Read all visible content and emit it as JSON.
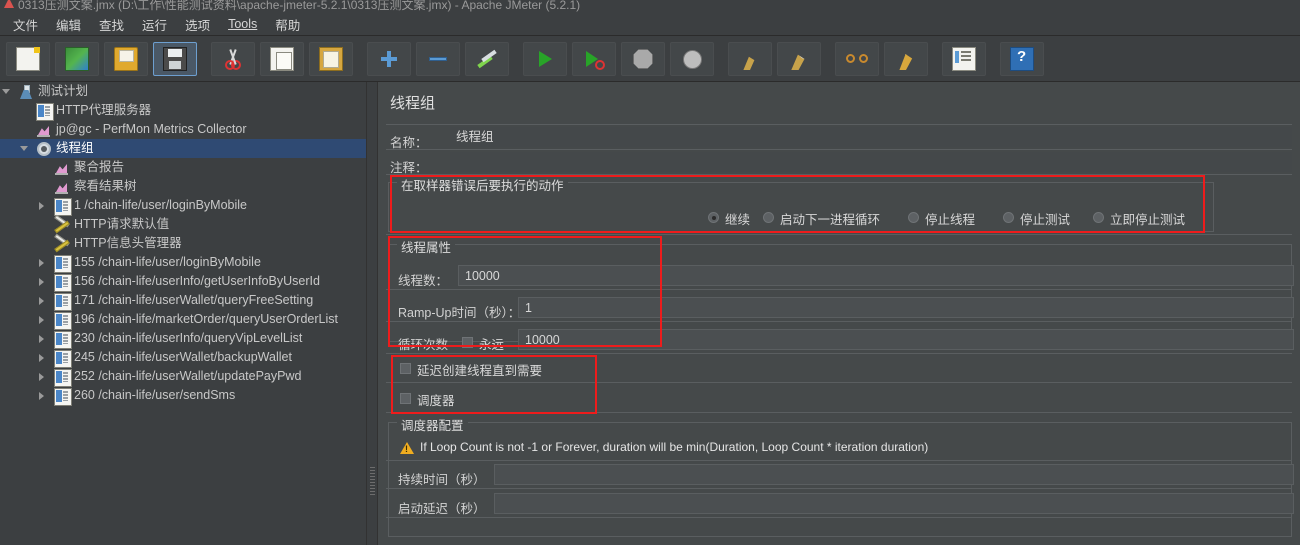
{
  "window": {
    "title": "0313压测文案.jmx (D:\\工作\\性能测试资料\\apache-jmeter-5.2.1\\0313压测文案.jmx) - Apache JMeter (5.2.1)",
    "app_icon": "jmeter-icon"
  },
  "menu": {
    "items": [
      {
        "label": "文件",
        "name": "menu-file"
      },
      {
        "label": "编辑",
        "name": "menu-edit"
      },
      {
        "label": "查找",
        "name": "menu-search"
      },
      {
        "label": "运行",
        "name": "menu-run"
      },
      {
        "label": "选项",
        "name": "menu-options"
      },
      {
        "label": "Tools",
        "name": "menu-tools"
      },
      {
        "label": "帮助",
        "name": "menu-help"
      }
    ]
  },
  "toolbar": {
    "buttons": [
      {
        "name": "new-button",
        "icon": "new-document-icon",
        "tooltip": "新建",
        "selected": false
      },
      {
        "name": "templates-button",
        "icon": "templates-icon",
        "tooltip": "模板",
        "selected": false
      },
      {
        "name": "open-button",
        "icon": "open-folder-icon",
        "tooltip": "打开",
        "selected": false
      },
      {
        "name": "save-button",
        "icon": "save-disk-icon",
        "tooltip": "保存",
        "selected": true
      },
      {
        "name": "cut-button",
        "icon": "scissors-icon",
        "tooltip": "剪切",
        "selected": false
      },
      {
        "name": "copy-button",
        "icon": "copy-icon",
        "tooltip": "复制",
        "selected": false
      },
      {
        "name": "paste-button",
        "icon": "clipboard-paste-icon",
        "tooltip": "粘贴",
        "selected": false
      },
      {
        "name": "expand-all-button",
        "icon": "plus-icon",
        "tooltip": "展开全部",
        "selected": false
      },
      {
        "name": "collapse-all-button",
        "icon": "minus-icon",
        "tooltip": "折叠全部",
        "selected": false
      },
      {
        "name": "toggle-button",
        "icon": "toggle-icon",
        "tooltip": "切换",
        "selected": false
      },
      {
        "name": "start-button",
        "icon": "play-green-icon",
        "tooltip": "启动",
        "selected": false
      },
      {
        "name": "start-no-pauses-button",
        "icon": "play-no-pause-icon",
        "tooltip": "无间断启动",
        "selected": false
      },
      {
        "name": "stop-button",
        "icon": "stop-octagon-icon",
        "tooltip": "停止",
        "selected": false
      },
      {
        "name": "shutdown-button",
        "icon": "shutdown-circle-icon",
        "tooltip": "关闭",
        "selected": false
      },
      {
        "name": "clear-button",
        "icon": "clear-broom-icon",
        "tooltip": "清除",
        "selected": false
      },
      {
        "name": "clear-all-button",
        "icon": "clear-all-broom-icon",
        "tooltip": "清除全部",
        "selected": false
      },
      {
        "name": "search-button",
        "icon": "binoculars-search-icon",
        "tooltip": "查找",
        "selected": false
      },
      {
        "name": "reset-search-button",
        "icon": "search-clear-icon",
        "tooltip": "重置查找",
        "selected": false
      },
      {
        "name": "function-helper-button",
        "icon": "function-helper-icon",
        "tooltip": "函数助手",
        "selected": false
      },
      {
        "name": "help-button",
        "icon": "help-book-icon",
        "tooltip": "帮助",
        "selected": false
      }
    ]
  },
  "tree": {
    "nodes": [
      {
        "label": "测试计划",
        "icon": "test-plan-icon",
        "depth": 0,
        "twisty": "open",
        "selected": false
      },
      {
        "label": "HTTP代理服务器",
        "icon": "http-icon",
        "depth": 1,
        "twisty": "none",
        "selected": false
      },
      {
        "label": "jp@gc - PerfMon Metrics Collector",
        "icon": "chart-icon",
        "depth": 1,
        "twisty": "none",
        "selected": false
      },
      {
        "label": "线程组",
        "icon": "gear-icon",
        "depth": 1,
        "twisty": "open",
        "selected": true
      },
      {
        "label": "聚合报告",
        "icon": "chart-icon",
        "depth": 2,
        "twisty": "none",
        "selected": false
      },
      {
        "label": "察看结果树",
        "icon": "chart-icon",
        "depth": 2,
        "twisty": "none",
        "selected": false
      },
      {
        "label": "1 /chain-life/user/loginByMobile",
        "icon": "http-icon",
        "depth": 2,
        "twisty": "closed",
        "selected": false
      },
      {
        "label": "HTTP请求默认值",
        "icon": "config-icon",
        "depth": 2,
        "twisty": "none",
        "selected": false
      },
      {
        "label": "HTTP信息头管理器",
        "icon": "config-icon",
        "depth": 2,
        "twisty": "none",
        "selected": false
      },
      {
        "label": "155 /chain-life/user/loginByMobile",
        "icon": "http-icon",
        "depth": 2,
        "twisty": "closed",
        "selected": false
      },
      {
        "label": "156 /chain-life/userInfo/getUserInfoByUserId",
        "icon": "http-icon",
        "depth": 2,
        "twisty": "closed",
        "selected": false
      },
      {
        "label": "171 /chain-life/userWallet/queryFreeSetting",
        "icon": "http-icon",
        "depth": 2,
        "twisty": "closed",
        "selected": false
      },
      {
        "label": "196 /chain-life/marketOrder/queryUserOrderList",
        "icon": "http-icon",
        "depth": 2,
        "twisty": "closed",
        "selected": false
      },
      {
        "label": "230 /chain-life/userInfo/queryVipLevelList",
        "icon": "http-icon",
        "depth": 2,
        "twisty": "closed",
        "selected": false
      },
      {
        "label": "245 /chain-life/userWallet/backupWallet",
        "icon": "http-icon",
        "depth": 2,
        "twisty": "closed",
        "selected": false
      },
      {
        "label": "252 /chain-life/userWallet/updatePayPwd",
        "icon": "http-icon",
        "depth": 2,
        "twisty": "closed",
        "selected": false
      },
      {
        "label": "260 /chain-life/user/sendSms",
        "icon": "http-icon",
        "depth": 2,
        "twisty": "closed",
        "selected": false
      }
    ]
  },
  "panel": {
    "title": "线程组",
    "name_label": "名称：",
    "name_value": "线程组",
    "comment_label": "注释：",
    "comment_value": "",
    "error_action": {
      "legend": "在取样器错误后要执行的动作",
      "options": [
        {
          "label": "继续",
          "selected": true,
          "name": "radio-continue"
        },
        {
          "label": "启动下一进程循环",
          "selected": false,
          "name": "radio-start-next-loop"
        },
        {
          "label": "停止线程",
          "selected": false,
          "name": "radio-stop-thread"
        },
        {
          "label": "停止测试",
          "selected": false,
          "name": "radio-stop-test"
        },
        {
          "label": "立即停止测试",
          "selected": false,
          "name": "radio-stop-test-now"
        }
      ]
    },
    "thread_properties": {
      "legend": "线程属性",
      "threads_label": "线程数：",
      "threads_value": "10000",
      "rampup_label": "Ramp-Up时间（秒）：",
      "rampup_value": "1",
      "loop_label": "循环次数",
      "forever_label": "永远",
      "forever_checked": false,
      "loop_value": "10000"
    },
    "options": [
      {
        "label": "延迟创建线程直到需要",
        "checked": false,
        "name": "checkbox-delayed-thread-creation"
      },
      {
        "label": "调度器",
        "checked": false,
        "name": "checkbox-scheduler"
      }
    ],
    "scheduler": {
      "legend": "调度器配置",
      "warning": "If Loop Count is not -1 or Forever, duration will be min(Duration, Loop Count * iteration duration)",
      "duration_label": "持续时间（秒）",
      "duration_value": "",
      "startup_delay_label": "启动延迟（秒）",
      "startup_delay_value": ""
    }
  },
  "annotations": {
    "color": "#ee1c1c",
    "boxes": [
      {
        "name": "annotation-error-action",
        "target": "在取样器错误后要执行的动作"
      },
      {
        "name": "annotation-thread-properties",
        "target": "线程属性"
      },
      {
        "name": "annotation-thread-options",
        "target": "延迟创建线程直到需要 / 调度器"
      }
    ]
  }
}
